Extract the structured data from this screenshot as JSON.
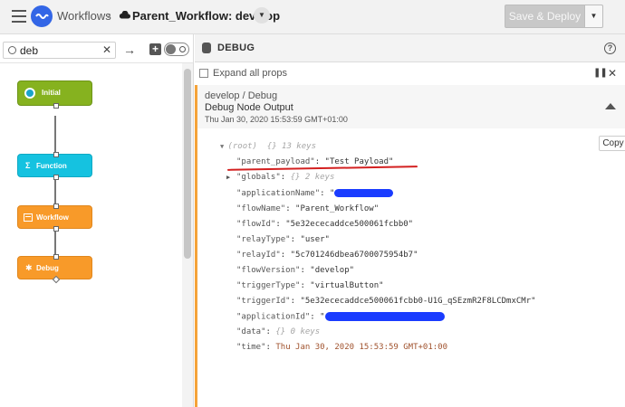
{
  "header": {
    "breadcrumb_root": "Workflows",
    "breadcrumb_sep": "›",
    "workflow_title": "Parent_Workflow: develop",
    "save_label": "Save & Deploy"
  },
  "left": {
    "search_value": "deb",
    "nodes": [
      {
        "label": "Initial",
        "color": "#7cab1c"
      },
      {
        "label": "Function",
        "color": "#11c3e0"
      },
      {
        "label": "Workflow",
        "color": "#f89a29"
      },
      {
        "label": "Debug",
        "color": "#f89a29"
      }
    ]
  },
  "debug": {
    "title": "DEBUG",
    "expand_label": "Expand all props",
    "message": {
      "source": "develop / Debug",
      "name": "Debug Node Output",
      "time": "Thu Jan 30, 2020 15:53:59 GMT+01:00",
      "copy_label": "Copy",
      "root_label": "(root)",
      "root_meta": "{} 13 keys",
      "rows": [
        {
          "key": "\"parent_payload\"",
          "value": "\"Test Payload\""
        },
        {
          "key": "\"globals\"",
          "value": "{} 2 keys"
        },
        {
          "key": "\"applicationName\"",
          "value": "\""
        },
        {
          "key": "\"flowName\"",
          "value": "\"Parent_Workflow\""
        },
        {
          "key": "\"flowId\"",
          "value": "\"5e32ececaddce500061fcbb0\""
        },
        {
          "key": "\"relayType\"",
          "value": "\"user\""
        },
        {
          "key": "\"relayId\"",
          "value": "\"5c701246dbea6700075954b7\""
        },
        {
          "key": "\"flowVersion\"",
          "value": "\"develop\""
        },
        {
          "key": "\"triggerType\"",
          "value": "\"virtualButton\""
        },
        {
          "key": "\"triggerId\"",
          "value": "\"5e32ececaddce500061fcbb0-U1G_qSEzmR2F8LCDmxCMr\""
        },
        {
          "key": "\"applicationId\"",
          "value": "\""
        },
        {
          "key": "\"data\"",
          "value": "{} 0 keys"
        },
        {
          "key": "\"time\"",
          "value": "Thu Jan 30, 2020 15:53:59 GMT+01:00"
        }
      ]
    }
  }
}
